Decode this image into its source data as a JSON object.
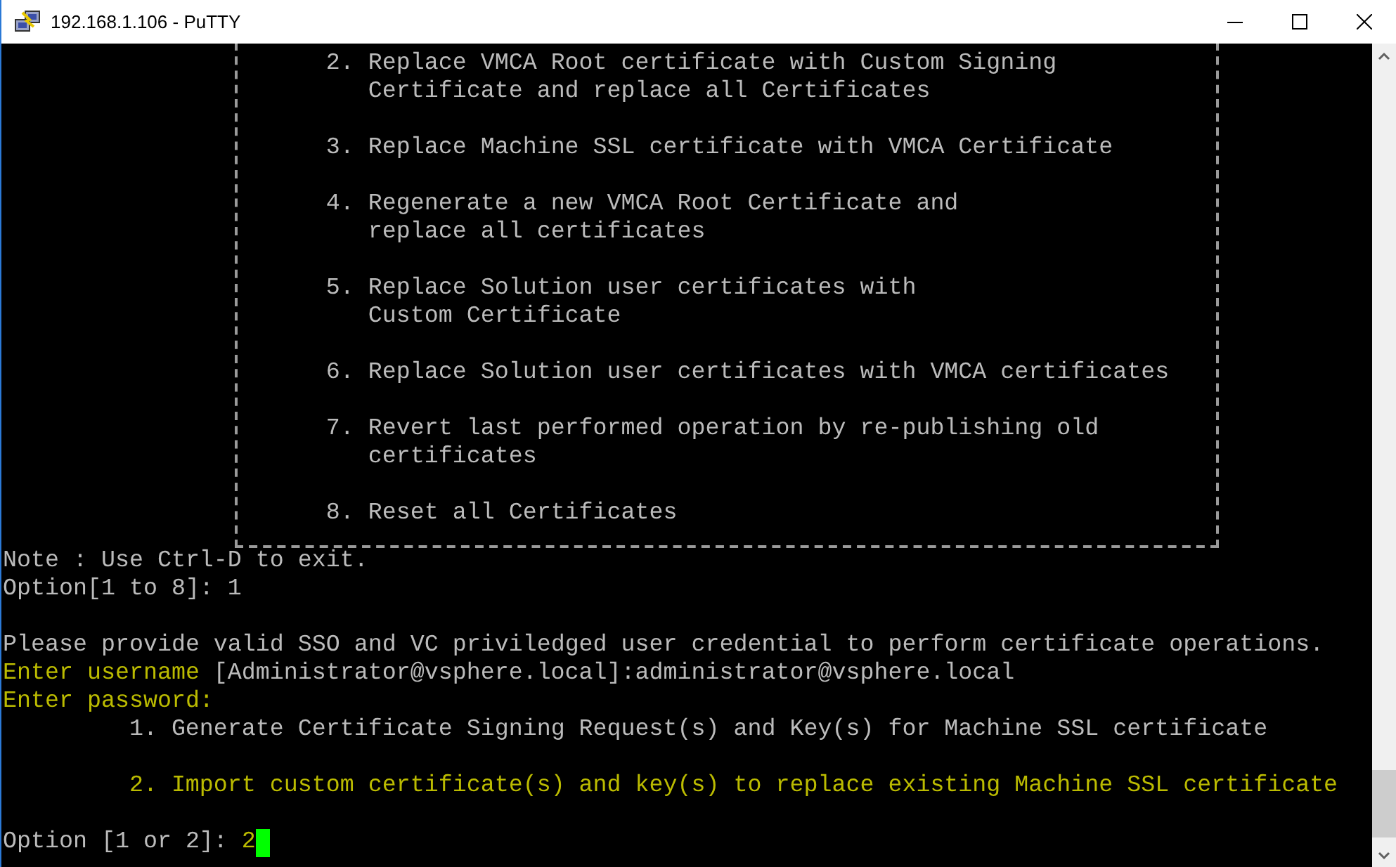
{
  "window": {
    "title": "192.168.1.106 - PuTTY"
  },
  "terminal": {
    "menu_box": {
      "items": [
        {
          "number": "2.",
          "lines": [
            "Replace VMCA Root certificate with Custom Signing",
            "Certificate and replace all Certificates"
          ]
        },
        {
          "number": "3.",
          "lines": [
            "Replace Machine SSL certificate with VMCA Certificate"
          ]
        },
        {
          "number": "4.",
          "lines": [
            "Regenerate a new VMCA Root Certificate and",
            "replace all certificates"
          ]
        },
        {
          "number": "5.",
          "lines": [
            "Replace Solution user certificates with",
            "Custom Certificate"
          ]
        },
        {
          "number": "6.",
          "lines": [
            "Replace Solution user certificates with VMCA certificates"
          ]
        },
        {
          "number": "7.",
          "lines": [
            "Revert last performed operation by re-publishing old",
            "certificates"
          ]
        },
        {
          "number": "8.",
          "lines": [
            "Reset all Certificates"
          ]
        }
      ]
    },
    "lines": [
      {
        "kind": "text",
        "segments": [
          {
            "kind": "output",
            "text": "Note : Use Ctrl-D to exit."
          }
        ]
      },
      {
        "kind": "text",
        "segments": [
          {
            "kind": "output",
            "text": "Option[1 to 8]: 1"
          }
        ]
      },
      {
        "kind": "blank"
      },
      {
        "kind": "text",
        "segments": [
          {
            "kind": "output",
            "text": "Please provide valid SSO and VC priviledged user credential to perform certificate operations."
          }
        ]
      },
      {
        "kind": "text",
        "segments": [
          {
            "kind": "prompt",
            "text": "Enter username"
          },
          {
            "kind": "output",
            "text": "[Administrator@vsphere.local]:administrator@vsphere.local"
          }
        ]
      },
      {
        "kind": "text",
        "segments": [
          {
            "kind": "prompt",
            "text": "Enter password:"
          }
        ]
      },
      {
        "kind": "choice",
        "segments": [
          {
            "kind": "output",
            "text": "1. Generate Certificate Signing Request(s) and Key(s) for Machine SSL certificate"
          }
        ]
      },
      {
        "kind": "blank"
      },
      {
        "kind": "choice",
        "segments": [
          {
            "kind": "prompt",
            "text": "2. Import custom certificate(s) and key(s) to replace existing Machine SSL certificate"
          }
        ]
      },
      {
        "kind": "blank"
      },
      {
        "kind": "text",
        "segments": [
          {
            "kind": "output",
            "text": "Option [1 or 2]:"
          },
          {
            "kind": "prompt",
            "text": "2"
          }
        ]
      }
    ]
  }
}
